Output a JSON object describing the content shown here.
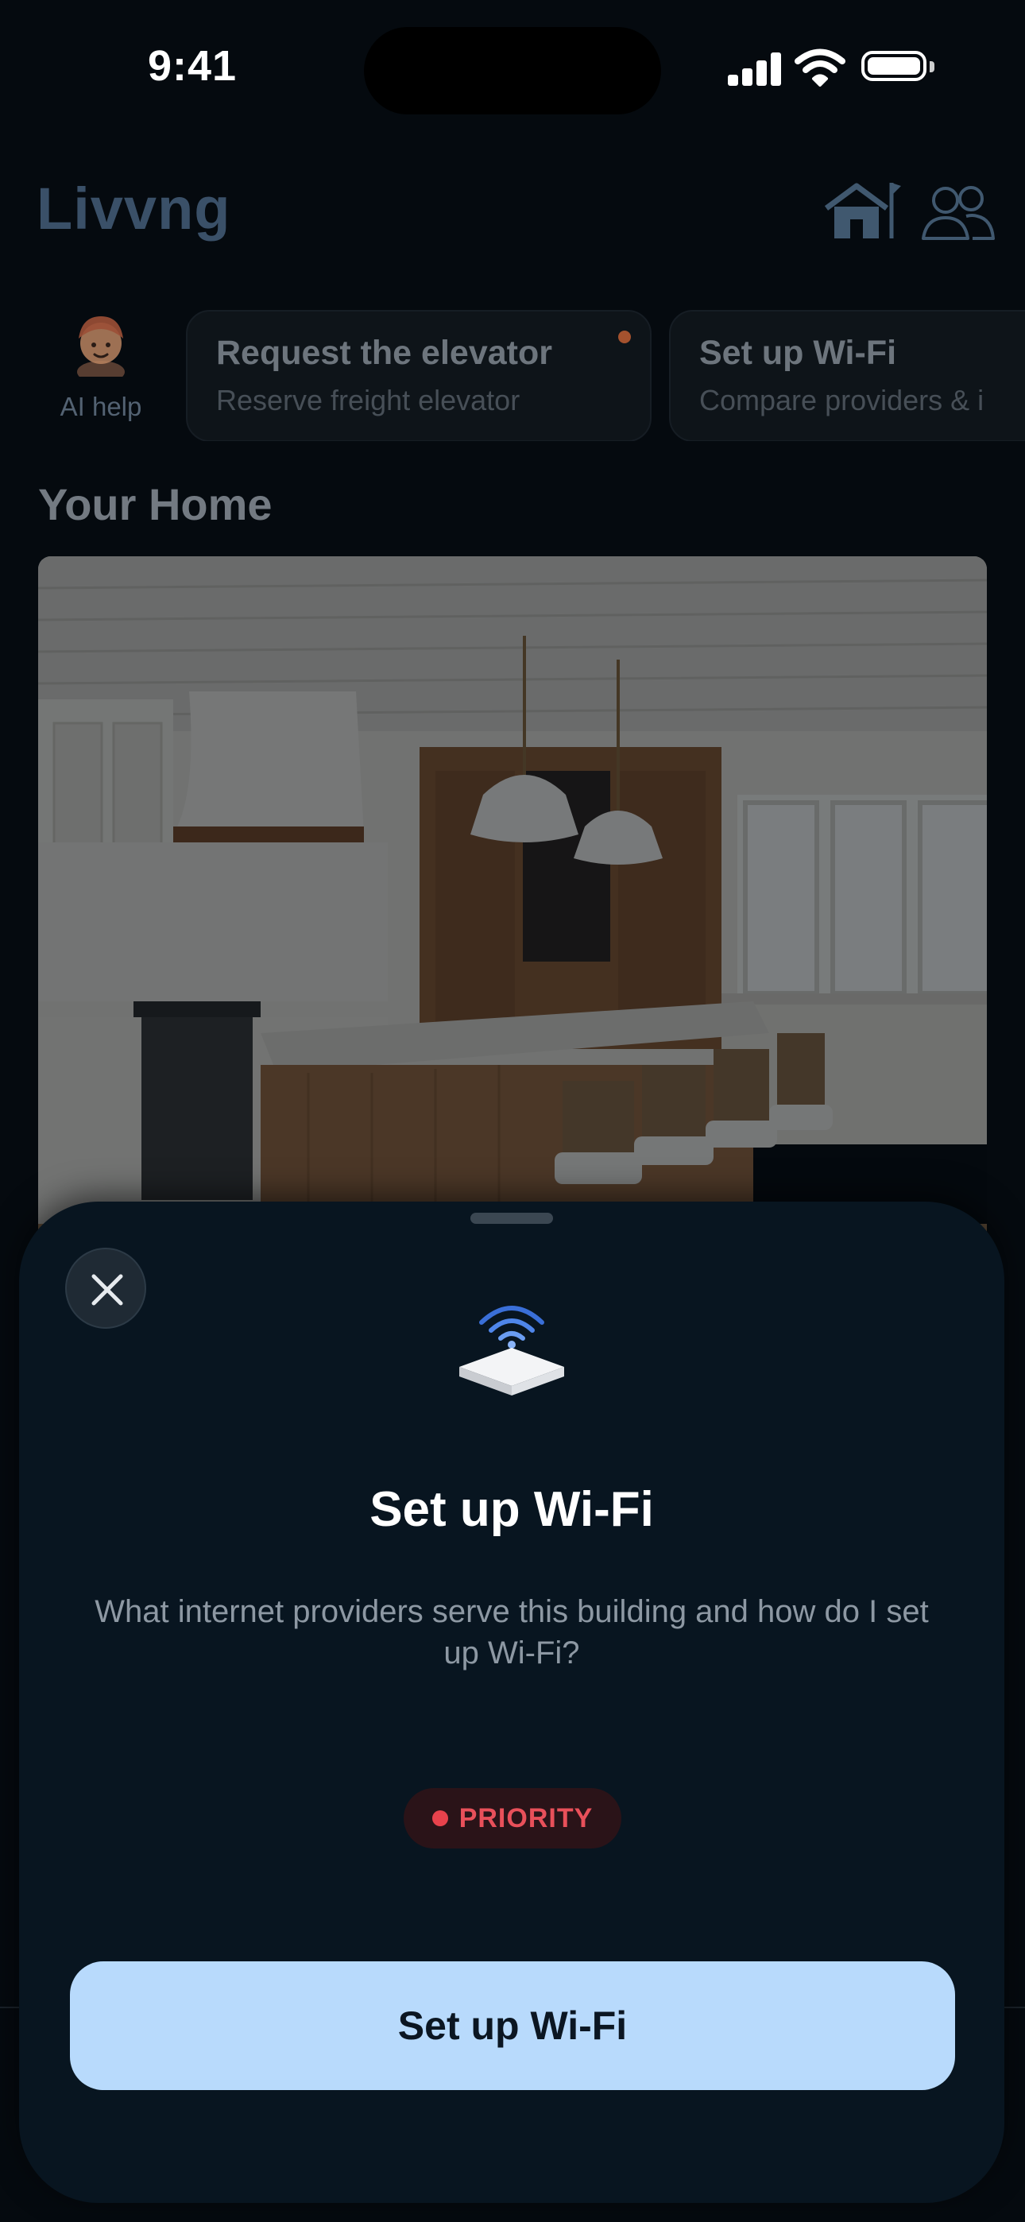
{
  "status_bar": {
    "time": "9:41"
  },
  "header": {
    "logo": "Livvng"
  },
  "ai_help": {
    "label": "AI help"
  },
  "chips": [
    {
      "title": "Request the elevator",
      "subtitle": "Reserve freight elevator",
      "has_dot": true
    },
    {
      "title": "Set up Wi-Fi",
      "subtitle": "Compare providers & i"
    }
  ],
  "home": {
    "section_title": "Your Home",
    "photo_icon": "kitchen-photo"
  },
  "sheet": {
    "title": "Set up Wi-Fi",
    "description": "What internet providers serve this building and how do I set up Wi-Fi?",
    "badge": "PRIORITY",
    "button_label": "Set up Wi-Fi",
    "icon": "router-icon"
  },
  "colors": {
    "accent_button": "#b8dafc",
    "priority_red": "#e8424c",
    "sheet_bg": "#081520",
    "logo": "#3a5068"
  }
}
